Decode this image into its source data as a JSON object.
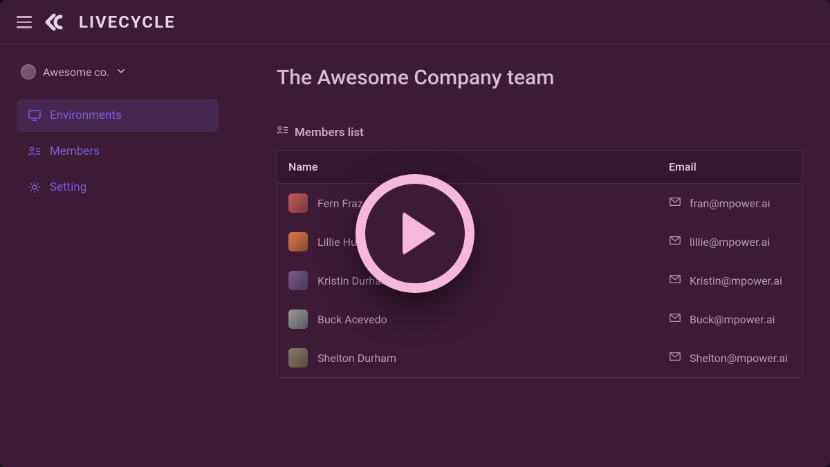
{
  "header": {
    "brand": "LIVECYCLE"
  },
  "sidebar": {
    "org_name": "Awesome co.",
    "items": [
      {
        "label": "Environments",
        "icon": "monitor-icon",
        "active": true
      },
      {
        "label": "Members",
        "icon": "members-icon",
        "active": false
      },
      {
        "label": "Setting",
        "icon": "gear-icon",
        "active": false
      }
    ]
  },
  "main": {
    "title": "The Awesome Company team",
    "section_label": "Members list",
    "columns": {
      "name": "Name",
      "email": "Email"
    },
    "members": [
      {
        "name": "Fern Fraz",
        "email": "fran@mpower.ai"
      },
      {
        "name": "Lillie Hunt",
        "email": "lillie@mpower.ai"
      },
      {
        "name": "Kristin Durham",
        "email": "Kristin@mpower.ai"
      },
      {
        "name": "Buck Acevedo",
        "email": "Buck@mpower.ai"
      },
      {
        "name": "Shelton Durham",
        "email": "Shelton@mpower.ai"
      }
    ]
  }
}
